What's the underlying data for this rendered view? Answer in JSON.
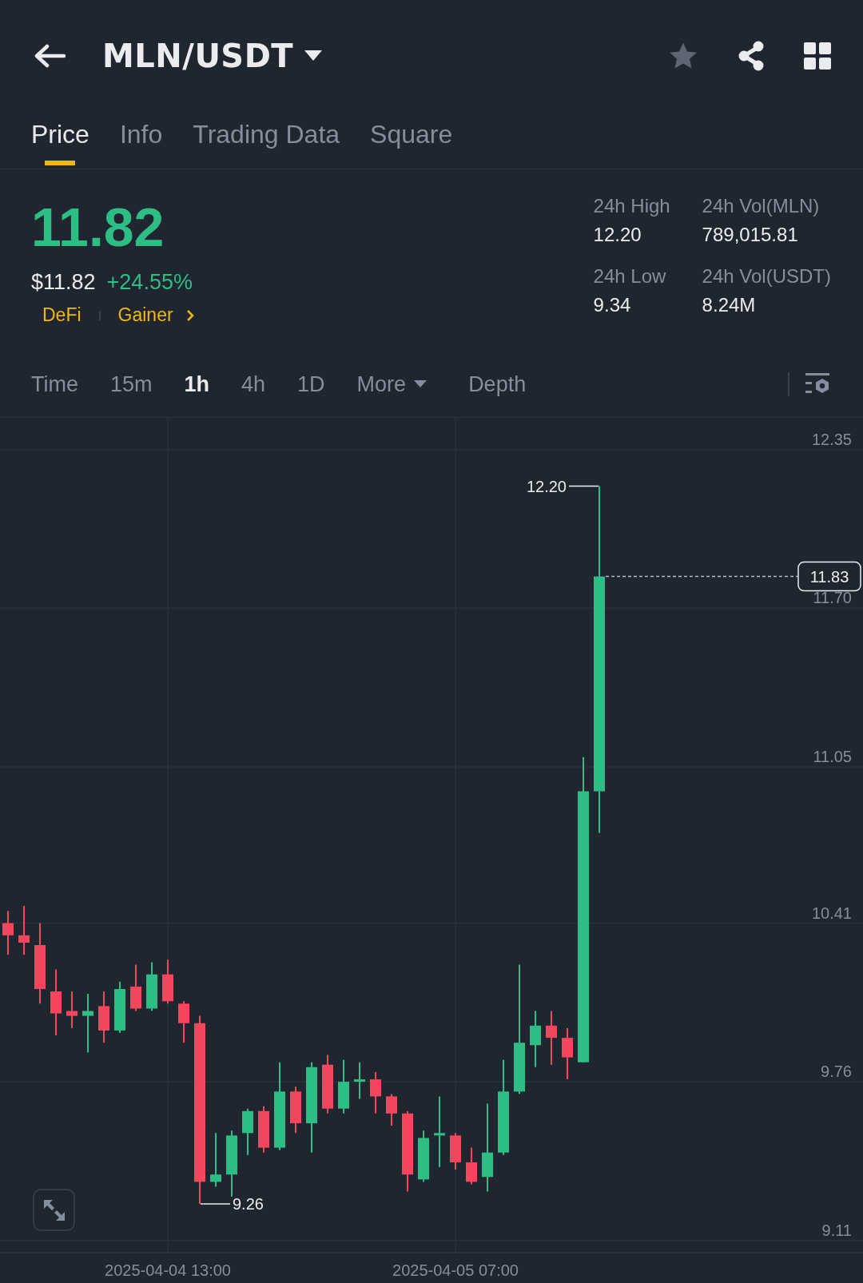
{
  "header": {
    "title": "MLN/USDT",
    "favorite": false
  },
  "tabs": [
    {
      "label": "Price",
      "selected": true
    },
    {
      "label": "Info",
      "selected": false
    },
    {
      "label": "Trading Data",
      "selected": false
    },
    {
      "label": "Square",
      "selected": false
    }
  ],
  "price": {
    "last": "11.82",
    "fiat": "$11.82",
    "change": "+24.55%",
    "tags": [
      "DeFi",
      "Gainer"
    ]
  },
  "stats": [
    {
      "label": "24h High",
      "value": "12.20"
    },
    {
      "label": "24h Vol(MLN)",
      "value": "789,015.81"
    },
    {
      "label": "24h Low",
      "value": "9.34"
    },
    {
      "label": "24h Vol(USDT)",
      "value": "8.24M"
    }
  ],
  "intervals": [
    {
      "label": "Time",
      "kind": "plain",
      "selected": false
    },
    {
      "label": "15m",
      "kind": "plain",
      "selected": false
    },
    {
      "label": "1h",
      "kind": "plain",
      "selected": true
    },
    {
      "label": "4h",
      "kind": "plain",
      "selected": false
    },
    {
      "label": "1D",
      "kind": "plain",
      "selected": false
    },
    {
      "label": "More",
      "kind": "menu",
      "selected": false
    },
    {
      "label": "Depth",
      "kind": "plain",
      "selected": false
    }
  ],
  "chart": {
    "chart_data": {
      "type": "candlestick",
      "categories": [
        null,
        null,
        null,
        null,
        null,
        null,
        null,
        null,
        null,
        null,
        "2025-04-04 13:00",
        null,
        null,
        null,
        null,
        null,
        null,
        null,
        null,
        null,
        null,
        null,
        null,
        null,
        null,
        null,
        null,
        null,
        "2025-04-05 07:00",
        null,
        null,
        null,
        null,
        null,
        null,
        null,
        null,
        null,
        null,
        null,
        null,
        null,
        null,
        null,
        null,
        null,
        null,
        null,
        null,
        null,
        null,
        null,
        null,
        null
      ],
      "ylim": [
        9.06,
        12.48
      ],
      "grid": true,
      "yticks": [
        12.35,
        {
          "value": 11.7,
          "label": "11.70"
        },
        11.05,
        10.41,
        9.76,
        9.11
      ],
      "ohlc": [
        [
          10.41,
          10.46,
          10.28,
          10.36
        ],
        [
          10.36,
          10.48,
          10.28,
          10.33
        ],
        [
          10.32,
          10.41,
          10.08,
          10.14
        ],
        [
          10.13,
          10.22,
          9.95,
          10.04
        ],
        [
          10.05,
          10.13,
          9.98,
          10.03
        ],
        [
          10.03,
          10.12,
          9.88,
          10.05
        ],
        [
          10.07,
          10.13,
          9.92,
          9.97
        ],
        [
          9.97,
          10.17,
          9.96,
          10.14
        ],
        [
          10.15,
          10.24,
          10.05,
          10.06
        ],
        [
          10.06,
          10.25,
          10.05,
          10.2
        ],
        [
          10.2,
          10.26,
          10.08,
          10.09
        ],
        [
          10.08,
          10.09,
          9.92,
          10.0
        ],
        [
          10.0,
          10.03,
          9.26,
          9.35
        ],
        [
          9.35,
          9.55,
          9.33,
          9.38
        ],
        [
          9.38,
          9.56,
          9.29,
          9.54
        ],
        [
          9.55,
          9.65,
          9.46,
          9.64
        ],
        [
          9.64,
          9.66,
          9.47,
          9.49
        ],
        [
          9.49,
          9.84,
          9.48,
          9.72
        ],
        [
          9.72,
          9.74,
          9.55,
          9.59
        ],
        [
          9.59,
          9.84,
          9.47,
          9.82
        ],
        [
          9.83,
          9.87,
          9.63,
          9.65
        ],
        [
          9.65,
          9.85,
          9.63,
          9.76
        ],
        [
          9.76,
          9.84,
          9.69,
          9.77
        ],
        [
          9.77,
          9.8,
          9.63,
          9.7
        ],
        [
          9.7,
          9.71,
          9.58,
          9.63
        ],
        [
          9.63,
          9.64,
          9.31,
          9.38
        ],
        [
          9.36,
          9.56,
          9.35,
          9.53
        ],
        [
          9.54,
          9.7,
          9.41,
          9.55
        ],
        [
          9.54,
          9.55,
          9.4,
          9.43
        ],
        [
          9.43,
          9.49,
          9.34,
          9.35
        ],
        [
          9.37,
          9.67,
          9.31,
          9.47
        ],
        [
          9.47,
          9.85,
          9.46,
          9.72
        ],
        [
          9.72,
          10.24,
          9.71,
          9.92
        ],
        [
          9.91,
          10.05,
          9.82,
          9.99
        ],
        [
          9.99,
          10.05,
          9.83,
          9.94
        ],
        [
          9.94,
          9.98,
          9.77,
          9.86
        ],
        [
          9.84,
          11.09,
          9.84,
          10.95
        ],
        [
          10.95,
          12.2,
          10.78,
          11.83
        ],
        null,
        null,
        null,
        null,
        null,
        null,
        null,
        null,
        null,
        null,
        null,
        null,
        null,
        null,
        null,
        null
      ],
      "annotations": [
        "12.20",
        "9.26",
        "11.83"
      ]
    }
  }
}
